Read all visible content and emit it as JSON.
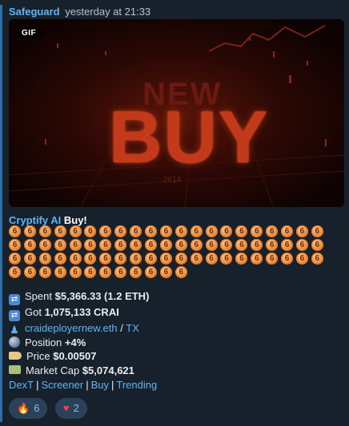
{
  "message": {
    "sender": "Safeguard",
    "time": "yesterday at 21:33",
    "media": {
      "badge": "GIF",
      "image_texts": {
        "new": "NEW",
        "buy": "BUY",
        "mark": "2614"
      }
    },
    "title": {
      "token": "Cryptify AI",
      "action": "Buy!"
    },
    "coin_rows": [
      21,
      21,
      21,
      12
    ],
    "coin_glyph": "6",
    "stats": [
      {
        "icon": "swap-icon",
        "glyph": "⇄",
        "label": "Spent",
        "value": "$5,366.33 (1.2 ETH)"
      },
      {
        "icon": "swap-icon",
        "glyph": "⇄",
        "label": "Got",
        "value": "1,075,133 CRAI"
      },
      {
        "icon": "person-icon",
        "link1": "craideployernew.eth",
        "separator": "/",
        "link2": "TX"
      },
      {
        "icon": "globe-icon",
        "label": "Position",
        "value": "+4%"
      },
      {
        "icon": "tag-icon",
        "label": "Price",
        "value": "$0.00507"
      },
      {
        "icon": "money-icon",
        "label": "Market Cap",
        "value": "$5,074,621"
      }
    ],
    "links": [
      "DexT",
      "Screener",
      "Buy",
      "Trending"
    ],
    "reactions": [
      {
        "icon": "fire-icon",
        "emoji": "🔥",
        "count": "6"
      },
      {
        "icon": "heart-icon",
        "emoji": "♥",
        "count": "2"
      }
    ]
  },
  "colors": {
    "background": "#17212b",
    "accent_link": "#5eb5f7",
    "reaction_bg": "#2b4159",
    "coin": "#f0903a"
  }
}
